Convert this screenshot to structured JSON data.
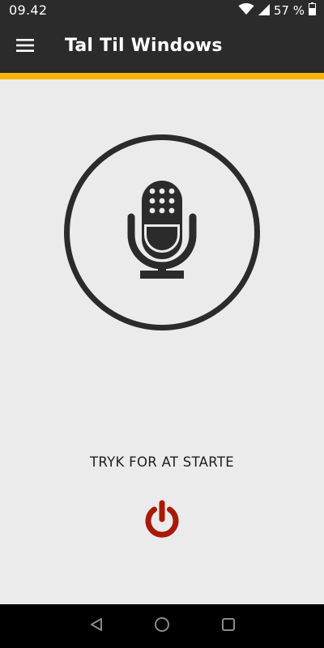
{
  "status_bar": {
    "time": "09.42",
    "battery_percent": "57 %",
    "icons": [
      "wifi-icon",
      "cell-signal-icon",
      "battery-icon"
    ]
  },
  "app_bar": {
    "title": "Tal Til Windows",
    "menu_icon": "hamburger-menu-icon"
  },
  "main": {
    "mic_icon": "microphone-icon",
    "start_label": "TRYK FOR AT STARTE",
    "power_icon": "power-icon"
  },
  "nav_bar": {
    "icons": [
      "back-icon",
      "home-icon",
      "recents-icon"
    ]
  },
  "colors": {
    "bar": "#2b2b2b",
    "accent": "#f6b400",
    "background": "#ebebeb",
    "power": "#a81a08"
  }
}
